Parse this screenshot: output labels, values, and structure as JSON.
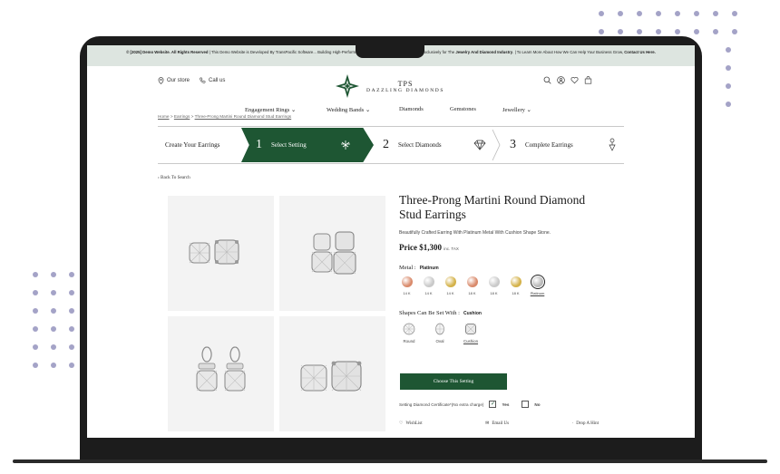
{
  "topbar": {
    "strong_prefix": "© [2025] Demo Website. All Rights Reserved",
    "text": " | This Demo Website is Developed By TransPacific Software... Building High-Performance, Custom E-Commerce Websites Exclusively for The ",
    "strong_mid": "Jewelry And Diamond Industry",
    "text2": ". | To Learn More About How We Can Help Your Business Grow, ",
    "strong_end": "Contact Us Here."
  },
  "utility": {
    "our_store": "Our store",
    "call_us": "Call us"
  },
  "logo": {
    "line1": "TPS",
    "line2": "DAZZLING DIAMONDS"
  },
  "nav": [
    "Engagement Rings",
    "Wedding Bands",
    "Diamonds",
    "Gemstones",
    "Jewellery"
  ],
  "breadcrumb": {
    "home": "Home",
    "earrings": "Earrings",
    "current": "Three-Prong Martini Round Diamond Stud Earrings"
  },
  "steps": {
    "start": "Create Your Earrings",
    "items": [
      {
        "num": "1",
        "label": "Select Setting"
      },
      {
        "num": "2",
        "label": "Select Diamonds"
      },
      {
        "num": "3",
        "label": "Complete Earrings"
      }
    ]
  },
  "back": "Back To Search",
  "product": {
    "title": "Three-Prong Martini Round Diamond Stud Earrings",
    "description": "Beautifully Crafted Earring With Platinum Metal With Cushion Shape Stone.",
    "price": "Price $1,300",
    "tax": "inc. TAX",
    "metal_label": "Metal :",
    "metal_selected": "Platinum",
    "metals": [
      {
        "label": "14 K",
        "color": "#d98a6b"
      },
      {
        "label": "14 K",
        "color": "#c9c9c9"
      },
      {
        "label": "14 K",
        "color": "#d4b24a"
      },
      {
        "label": "18 K",
        "color": "#d98a6b"
      },
      {
        "label": "18 K",
        "color": "#c9c9c9"
      },
      {
        "label": "18 K",
        "color": "#d4b24a"
      },
      {
        "label": "Platinum",
        "color": "#b8b8b8"
      }
    ],
    "shape_label": "Shapes Can Be Set With :",
    "shape_selected": "Cushion",
    "shapes": [
      "Round",
      "Oval",
      "Cushion"
    ],
    "choose_button": "Choose This Setting",
    "cert_label": "Setting Diamond Certificate*(No extra charge)",
    "cert_yes": "Yes",
    "cert_no": "No",
    "actions": [
      "WishList",
      "Email Us",
      "Drop A Hint"
    ]
  },
  "colors": {
    "brand_green": "#1e5633",
    "topbar_bg": "#dde5e0",
    "dot": "#a4a3c7"
  }
}
